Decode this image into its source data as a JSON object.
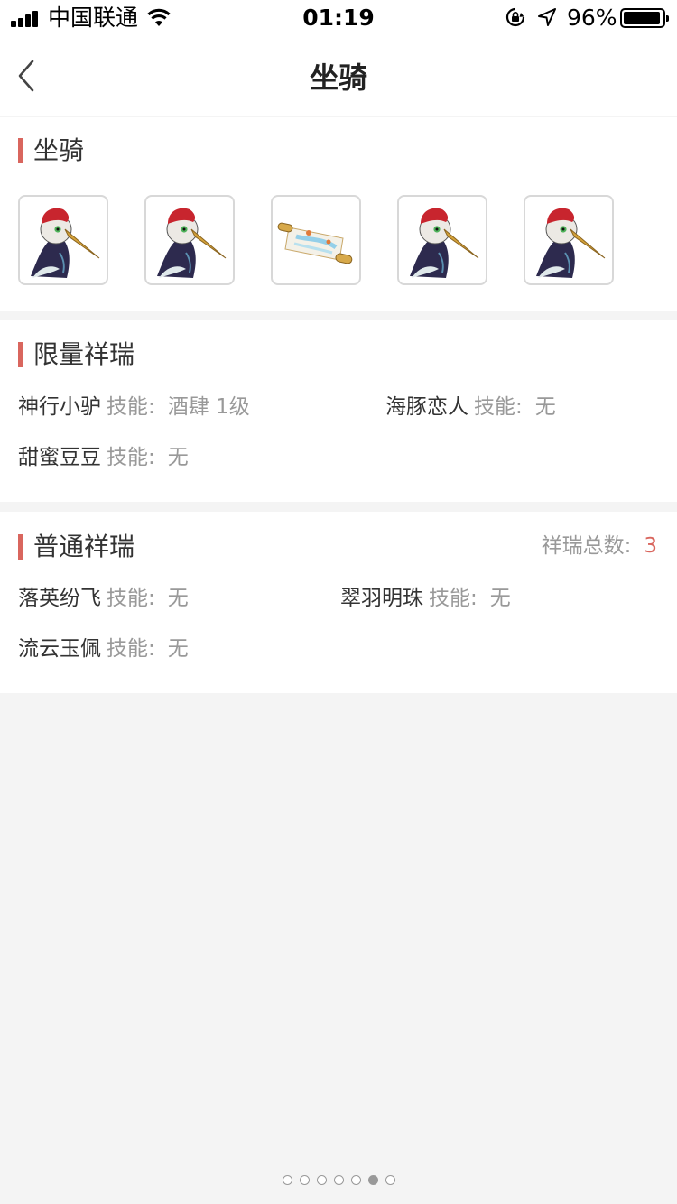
{
  "status_bar": {
    "carrier": "中国联通",
    "time": "01:19",
    "battery_pct": "96%",
    "signal_icon": "signal-bars-icon",
    "wifi_icon": "wifi-icon",
    "lock_icon": "rotation-lock-icon",
    "location_icon": "location-arrow-icon"
  },
  "nav": {
    "title": "坐骑",
    "back_icon": "chevron-left-icon"
  },
  "mounts": {
    "title": "坐骑",
    "thumbnails": [
      {
        "icon": "crane-icon"
      },
      {
        "icon": "crane-icon"
      },
      {
        "icon": "scroll-icon"
      },
      {
        "icon": "crane-icon"
      },
      {
        "icon": "crane-icon"
      }
    ]
  },
  "limited": {
    "title": "限量祥瑞",
    "items": [
      {
        "name": "神行小驴",
        "skill_label": "技能:",
        "skill_value": "酒肆 1级"
      },
      {
        "name": "海豚恋人",
        "skill_label": "技能:",
        "skill_value": "无"
      },
      {
        "name": "甜蜜豆豆",
        "skill_label": "技能:",
        "skill_value": "无"
      }
    ]
  },
  "normal": {
    "title": "普通祥瑞",
    "total_label": "祥瑞总数:",
    "total_value": "3",
    "items": [
      {
        "name": "落英纷飞",
        "skill_label": "技能:",
        "skill_value": "无"
      },
      {
        "name": "翠羽明珠",
        "skill_label": "技能:",
        "skill_value": "无"
      },
      {
        "name": "流云玉佩",
        "skill_label": "技能:",
        "skill_value": "无"
      }
    ]
  },
  "pager": {
    "count": 7,
    "active_index": 5
  },
  "colors": {
    "accent": "#d9665e",
    "muted_text": "#999999",
    "background": "#f4f4f4"
  }
}
